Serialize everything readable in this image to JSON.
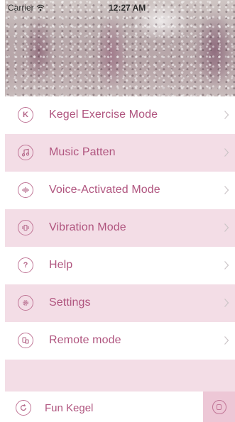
{
  "status_bar": {
    "carrier": "Carrier",
    "time": "12:27 AM"
  },
  "menu": {
    "items": [
      {
        "label": "Kegel Exercise Mode",
        "icon": "k-letter-icon",
        "icon_text": "K"
      },
      {
        "label": "Music Patten",
        "icon": "music-note-icon"
      },
      {
        "label": "Voice-Activated Mode",
        "icon": "sound-wave-icon"
      },
      {
        "label": "Vibration Mode",
        "icon": "vibration-icon"
      },
      {
        "label": "Help",
        "icon": "question-icon",
        "icon_text": "?"
      },
      {
        "label": "Settings",
        "icon": "gear-icon"
      },
      {
        "label": "Remote mode",
        "icon": "remote-icon"
      }
    ]
  },
  "footer": {
    "label": "Fun Kegel",
    "icon": "refresh-icon"
  },
  "colors": {
    "accent": "#b0557f",
    "row_alt": "#f3dde6",
    "icon_ring": "#c07596"
  }
}
